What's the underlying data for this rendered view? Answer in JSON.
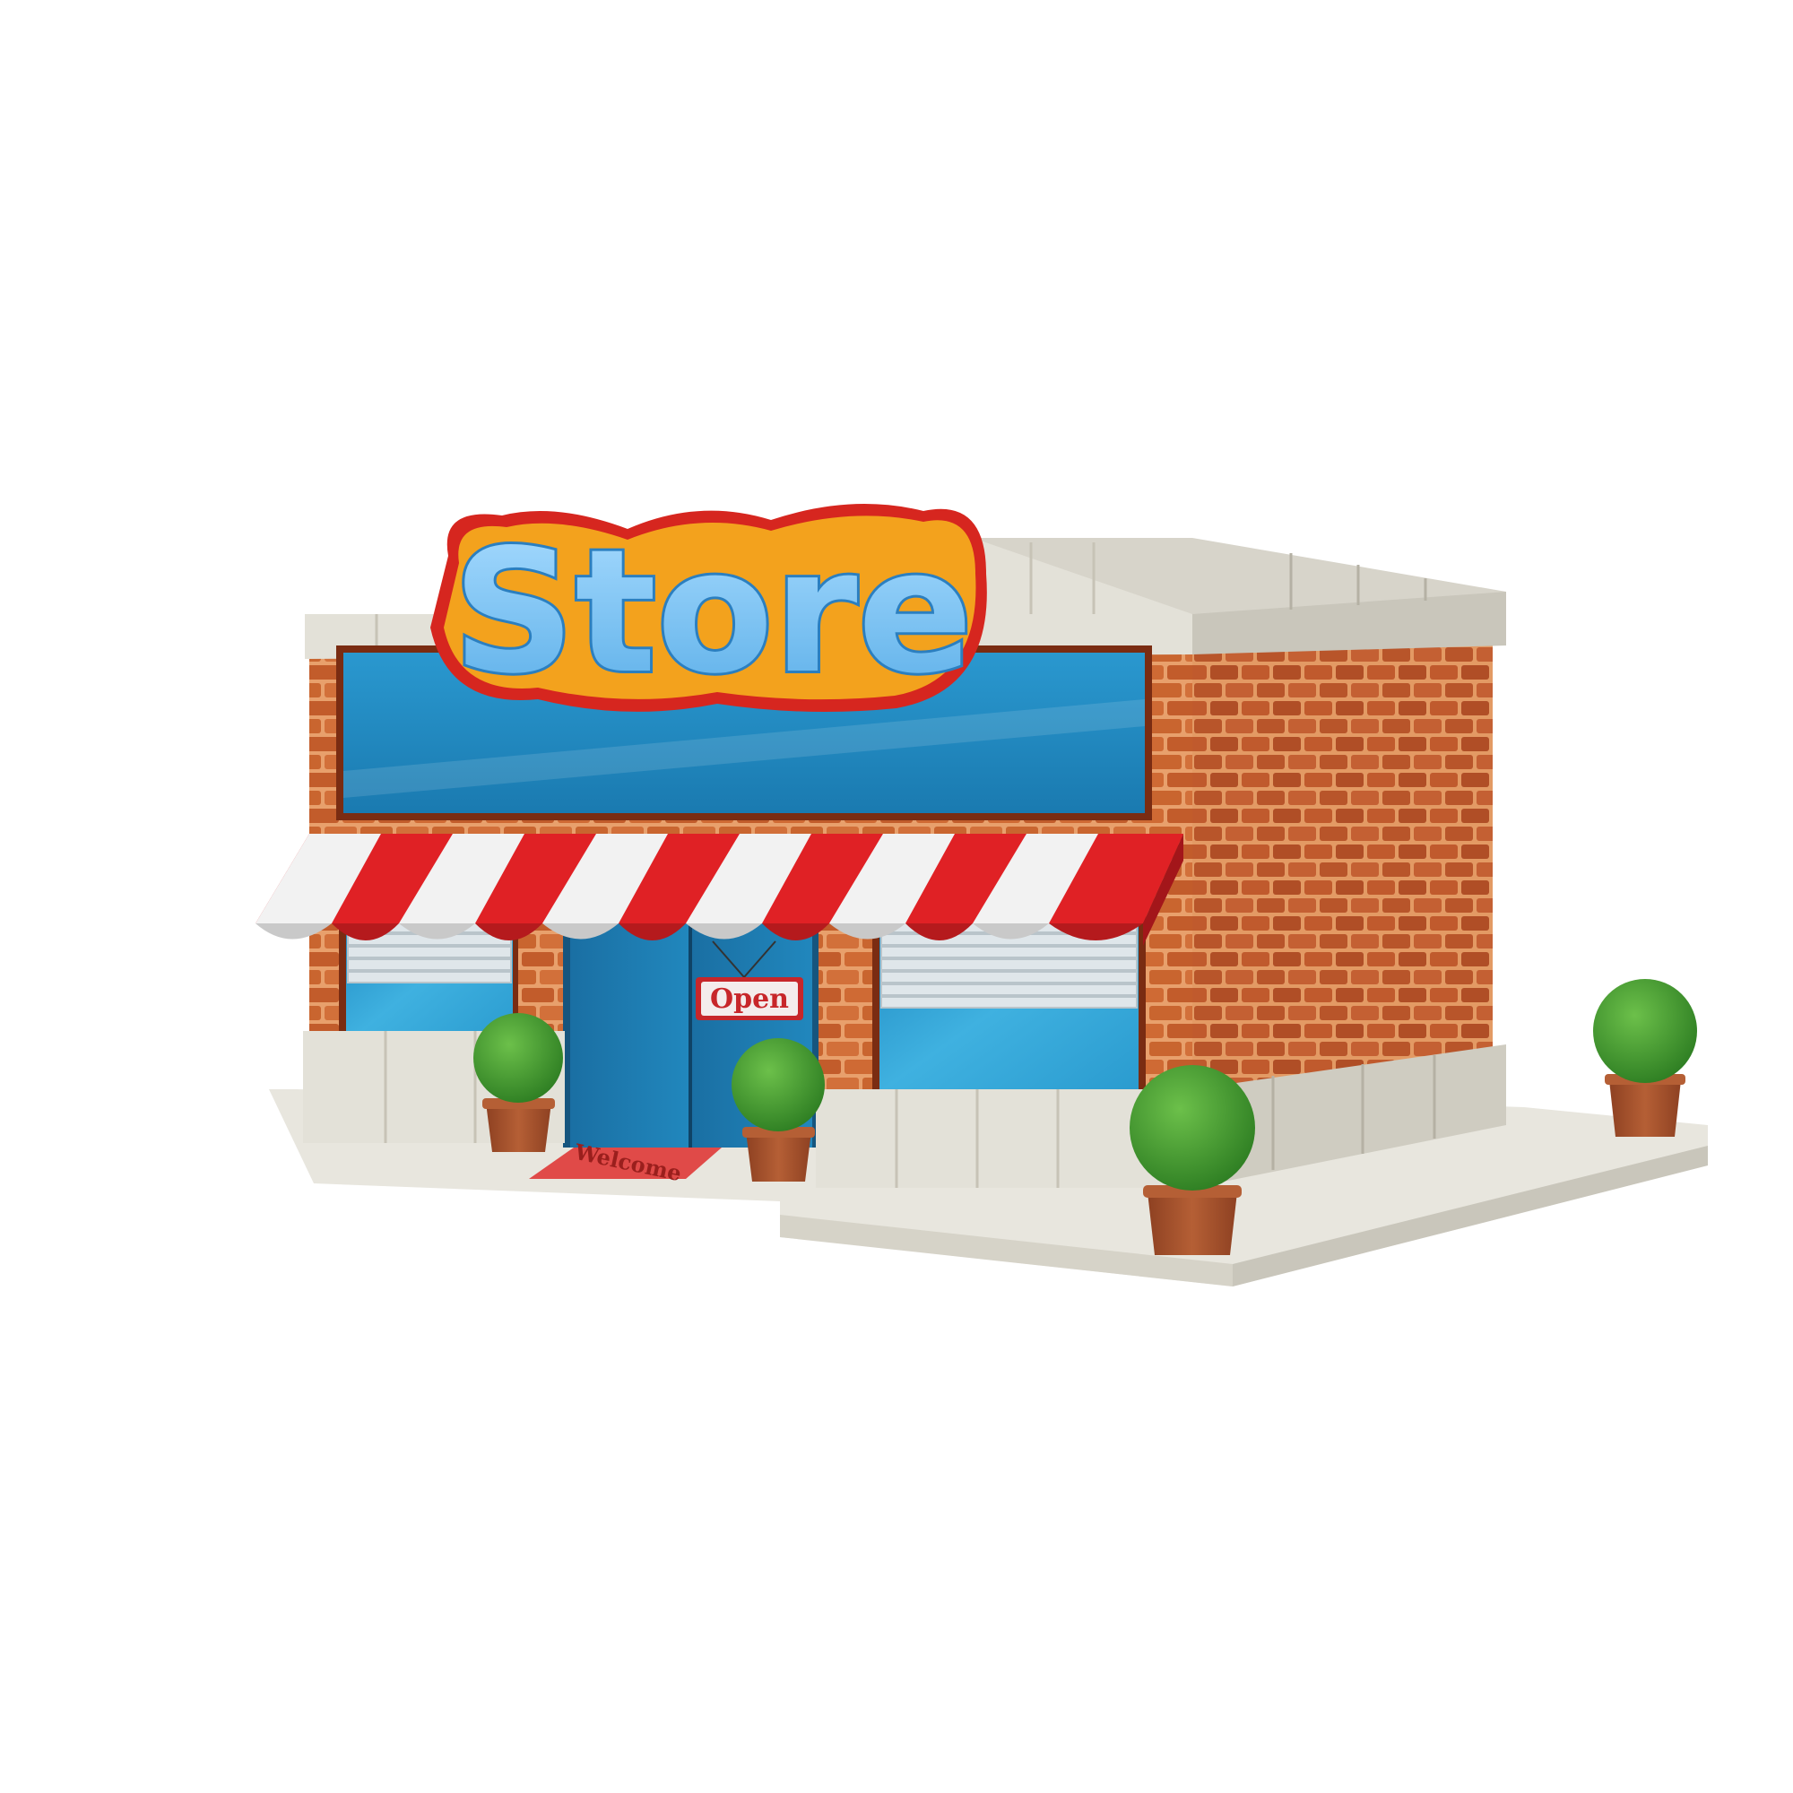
{
  "store_sign": {
    "text": "Store"
  },
  "door_sign": {
    "text": "Open"
  },
  "doormat": {
    "text": "Welcome"
  },
  "colors": {
    "brick": "#c9652f",
    "brick_side": "#b8552a",
    "mortar": "#e7a06a",
    "trim": "#e3e1d8",
    "trim_shadow": "#c9c6bb",
    "glass": "#2ea3d3",
    "door": "#1d7db1",
    "awning_red": "#e02125",
    "awning_white": "#f2f2f2",
    "sign_fill": "#7ec3f0",
    "sign_orange": "#f3a21d",
    "sign_red": "#d6261f",
    "leaves": "#3f9a2c",
    "pot": "#a5512c",
    "mat": "#e04a48",
    "ground": "#e5e3db"
  },
  "icons": [
    "storefront-building-icon",
    "potted-shrub-icon"
  ]
}
